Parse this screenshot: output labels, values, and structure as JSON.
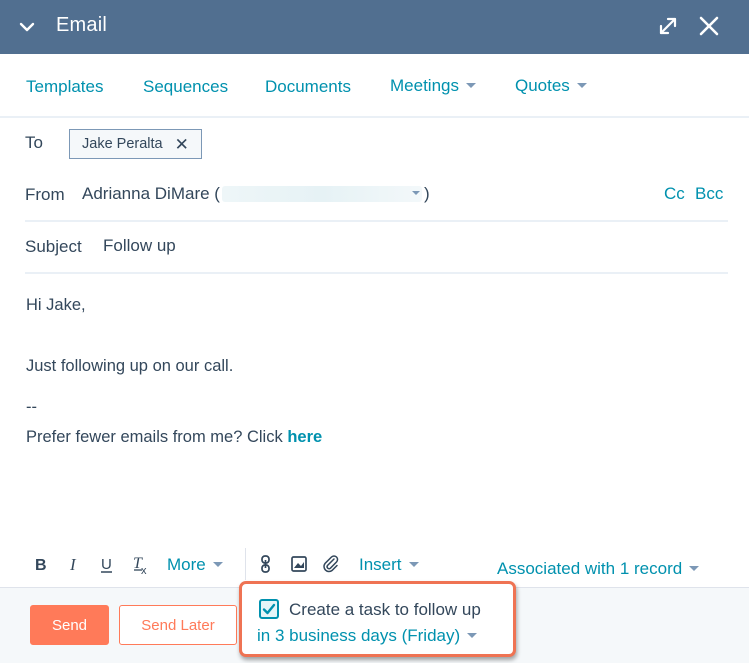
{
  "header": {
    "title": "Email",
    "collapse_icon": "chevron-down-icon",
    "expand_icon": "expand-icon",
    "close_icon": "close-icon"
  },
  "nav": {
    "tabs": [
      {
        "label": "Templates",
        "dropdown": false
      },
      {
        "label": "Sequences",
        "dropdown": false
      },
      {
        "label": "Documents",
        "dropdown": false
      },
      {
        "label": "Meetings",
        "dropdown": true
      },
      {
        "label": "Quotes",
        "dropdown": true
      }
    ]
  },
  "compose": {
    "to_label": "To",
    "to_recipients": [
      {
        "name": "Jake Peralta",
        "remove_icon": "close-icon"
      }
    ],
    "from_label": "From",
    "from_name": "Adrianna DiMare (",
    "from_suffix": ")",
    "cc_label": "Cc",
    "bcc_label": "Bcc",
    "subject_label": "Subject",
    "subject_value": "Follow up"
  },
  "body": {
    "greeting": "Hi Jake,",
    "line1": "Just following up on our call.",
    "signature_sep": "--",
    "unsubscribe_text": "Prefer fewer emails from me? Click ",
    "unsubscribe_link": "here"
  },
  "toolbar": {
    "bold_icon": "bold-icon",
    "italic_icon": "italic-icon",
    "underline_icon": "underline-icon",
    "clear_format_icon": "clear-formatting-icon",
    "more_label": "More",
    "link_icon": "link-icon",
    "image_icon": "image-icon",
    "attach_icon": "paperclip-icon",
    "insert_label": "Insert",
    "associated_label": "Associated with 1 record"
  },
  "footer": {
    "send_label": "Send",
    "send_later_label": "Send Later",
    "task_checked": true,
    "task_label": "Create a task to follow up",
    "task_when": "in 3 business days (Friday)"
  },
  "colors": {
    "header_bg": "#516f90",
    "link": "#0091ae",
    "primary": "#ff7a59",
    "highlight": "#ef7353",
    "text": "#33475b"
  }
}
